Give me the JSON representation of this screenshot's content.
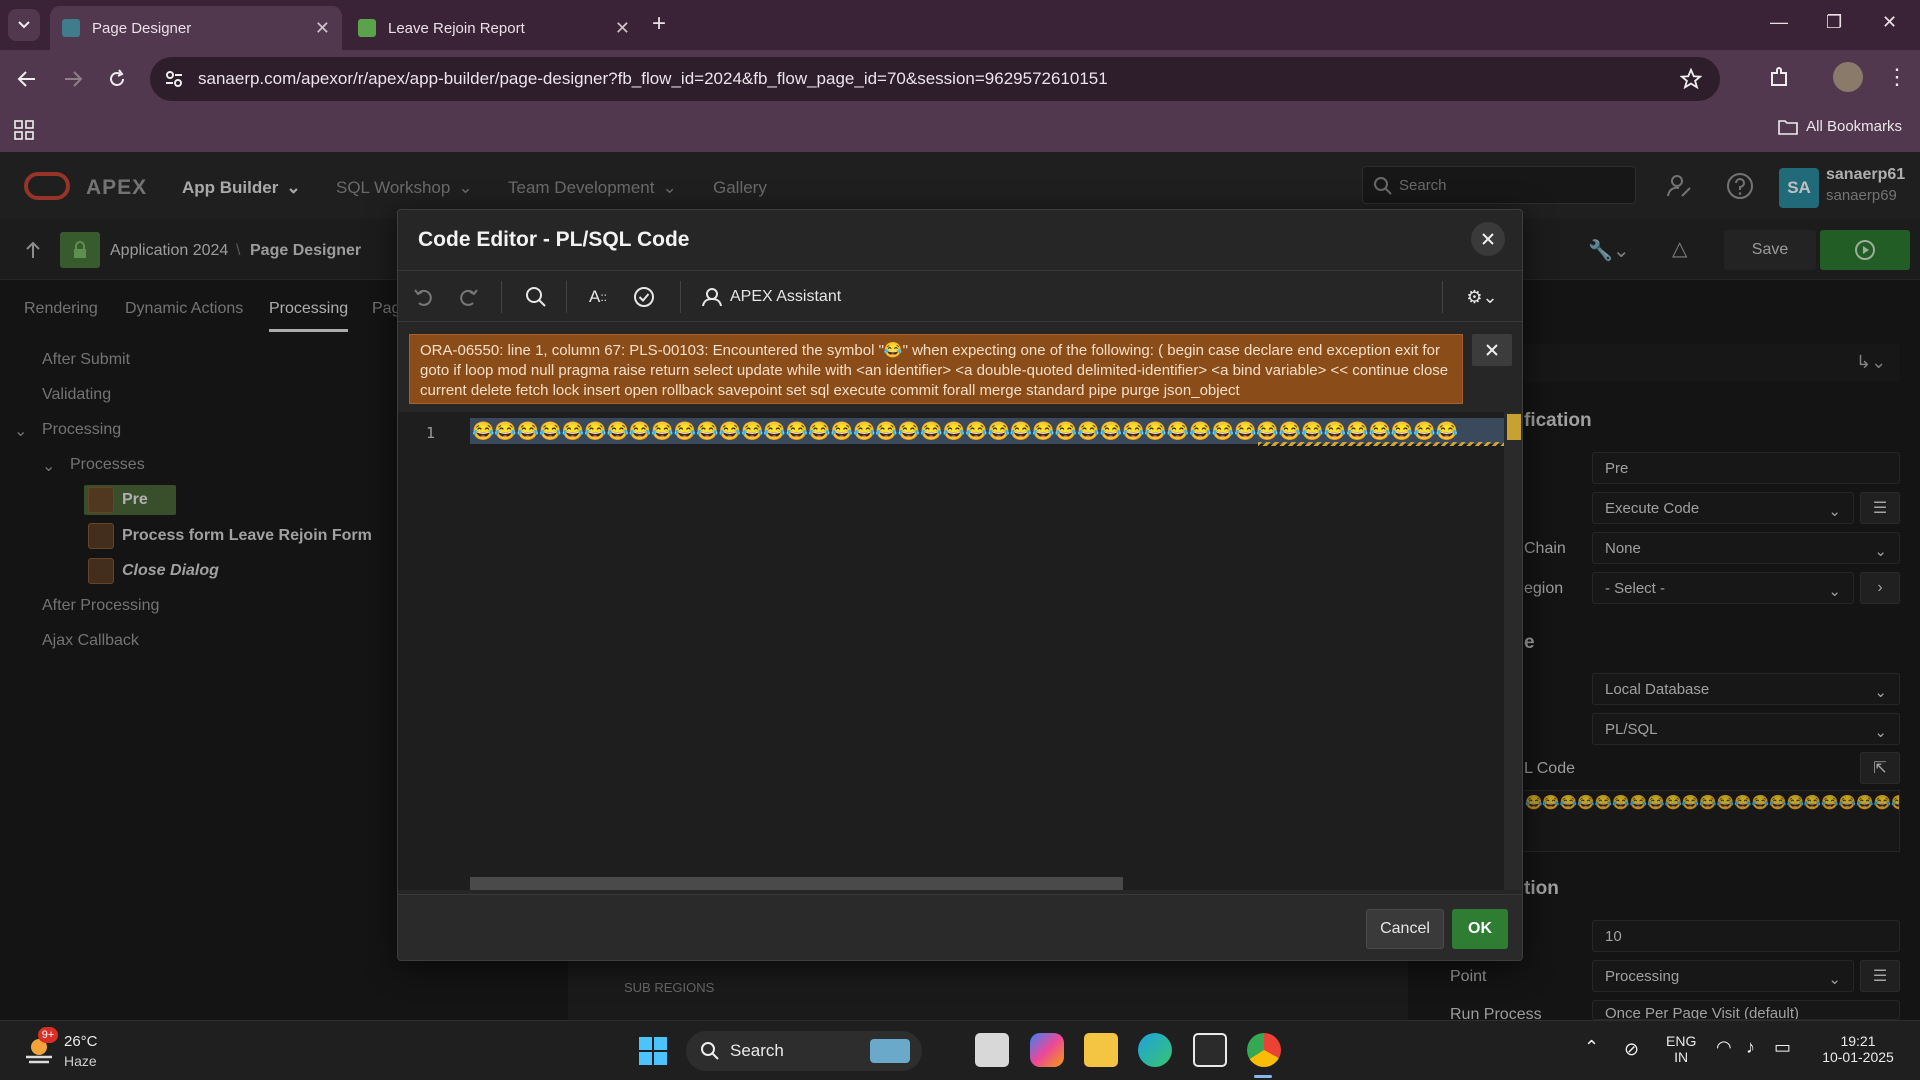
{
  "browser": {
    "tabs": [
      {
        "title": "Page Designer",
        "active": true
      },
      {
        "title": "Leave Rejoin Report",
        "active": false
      }
    ],
    "url": "sanaerp.com/apexor/r/apex/app-builder/page-designer?fb_flow_id=2024&fb_flow_page_id=70&session=9629572610151",
    "bookmarks_label": "All Bookmarks"
  },
  "apex_header": {
    "brand": "APEX",
    "menus": [
      "App Builder",
      "SQL Workshop",
      "Team Development",
      "Gallery"
    ],
    "search_placeholder": "Search",
    "avatar_initials": "SA",
    "user_name": "sanaerp61",
    "user_workspace": "sanaerp69"
  },
  "page_designer": {
    "breadcrumb_app": "Application 2024",
    "breadcrumb_sep": "\\",
    "breadcrumb_page": "Page Designer",
    "save_label": "Save",
    "left_tabs": [
      "Rendering",
      "Dynamic Actions",
      "Processing",
      "Pag"
    ],
    "tree": {
      "after_submit": "After Submit",
      "validating": "Validating",
      "processing": "Processing",
      "processes": "Processes",
      "pre": "Pre",
      "process_form": "Process form Leave Rejoin Form",
      "close_dialog": "Close Dialog",
      "after_processing": "After Processing",
      "ajax_callback": "Ajax Callback"
    },
    "sub_regions": "SUB REGIONS"
  },
  "property_panel": {
    "identification_head": "fication",
    "name_value": "Pre",
    "type_value": "Execute Code",
    "chain_label": "Chain",
    "chain_value": "None",
    "region_label": "egion",
    "region_value": "- Select -",
    "source_head": "e",
    "location_value": "Local Database",
    "language_value": "PL/SQL",
    "code_label": "L Code",
    "execution_head": "tion",
    "sequence_value": "10",
    "point_label": "Point",
    "point_value": "Processing",
    "run_process_label": "Run Process",
    "run_process_value": "Once Per Page Visit (default)"
  },
  "dialog": {
    "title": "Code Editor - PL/SQL Code",
    "assistant_label": "APEX Assistant",
    "error_message": "ORA-06550: line 1, column 67: PLS-00103: Encountered the symbol \"😂\" when expecting one of the following: ( begin case declare end exception exit for goto if loop mod null pragma raise return select update while with <an identifier> <a double-quoted delimited-identifier> <a bind variable> << continue close current delete fetch lock insert open rollback savepoint set sql execute commit forall merge standard pipe purge json_object",
    "line_number": "1",
    "code": "😂😂😂😂😂😂😂😂😂😂😂😂😂😂😂😂😂😂😂😂😂😂😂😂😂😂😂😂😂😂😂😂😂😂😂😂😂😂😂😂😂😂😂😂",
    "cancel_label": "Cancel",
    "ok_label": "OK"
  },
  "taskbar": {
    "weather_badge": "9+",
    "temperature": "26°C",
    "weather": "Haze",
    "search_label": "Search",
    "lang_line1": "ENG",
    "lang_line2": "IN",
    "time": "19:21",
    "date": "10-01-2025"
  },
  "colors": {
    "accent_green": "#2e7d32",
    "error_bg": "#8a4d19",
    "apex_red": "#c74634"
  }
}
